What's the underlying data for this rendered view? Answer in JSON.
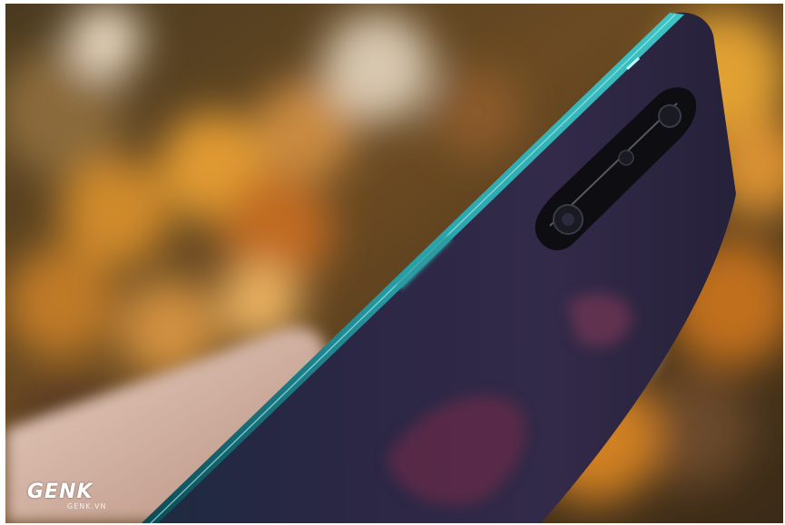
{
  "photo": {
    "subject": "phone-side-edge-closeup",
    "palette": {
      "background_warm": "#c8781e",
      "background_dark": "#2a1a10",
      "phone_body": "#2b2540",
      "phone_edge": "#1f8a8a",
      "hand": "#d8b8a8"
    }
  },
  "watermark": {
    "logo": "GENK",
    "site": "GENK.VN"
  }
}
